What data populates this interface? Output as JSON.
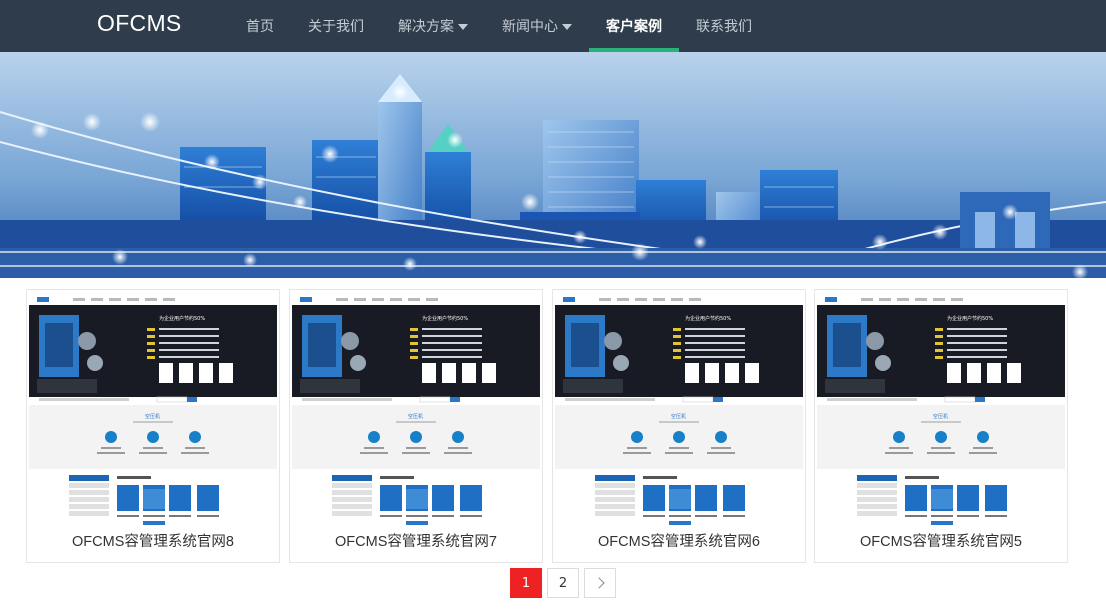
{
  "brand": "OFCMS",
  "nav": [
    {
      "label": "首页",
      "dropdown": false,
      "active": false
    },
    {
      "label": "关于我们",
      "dropdown": false,
      "active": false
    },
    {
      "label": "解决方案",
      "dropdown": true,
      "active": false
    },
    {
      "label": "新闻中心",
      "dropdown": true,
      "active": false
    },
    {
      "label": "客户案例",
      "dropdown": false,
      "active": true
    },
    {
      "label": "联系我们",
      "dropdown": false,
      "active": false
    }
  ],
  "colors": {
    "nav_bg": "#2e3c4b",
    "accent": "#2ab27b",
    "page_active": "#ee2222"
  },
  "cases": [
    {
      "title": "OFCMS容管理系统官网8"
    },
    {
      "title": "OFCMS容管理系统官网7"
    },
    {
      "title": "OFCMS容管理系统官网6"
    },
    {
      "title": "OFCMS容管理系统官网5"
    }
  ],
  "pagination": {
    "pages": [
      "1",
      "2"
    ],
    "current": "1",
    "next_icon": "chevron-right-icon"
  }
}
